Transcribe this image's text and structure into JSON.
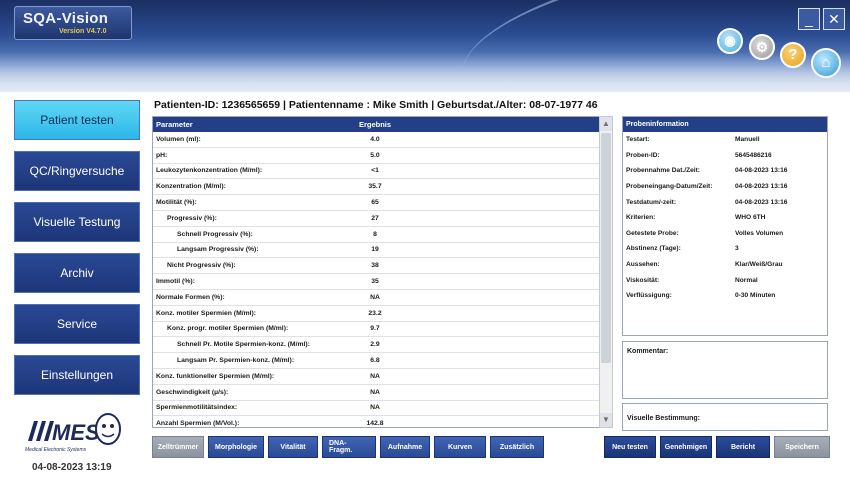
{
  "app": {
    "name": "SQA-Vision",
    "version": "Version V4.7.0"
  },
  "header": {
    "icons": [
      "eye-icon",
      "gear-icon",
      "help-icon",
      "home-icon"
    ],
    "window": {
      "minimize": "_",
      "close": "✕"
    }
  },
  "sidebar": {
    "items": [
      {
        "label": "Patient testen",
        "active": true
      },
      {
        "label": "QC/Ringversuche",
        "active": false
      },
      {
        "label": "Visuelle Testung",
        "active": false
      },
      {
        "label": "Archiv",
        "active": false
      },
      {
        "label": "Service",
        "active": false
      },
      {
        "label": "Einstellungen",
        "active": false
      }
    ],
    "logo_text": "MES",
    "logo_subtitle": "Medical Electronic Systems",
    "datetime": "04-08-2023 13:19"
  },
  "patient": {
    "line": "Patienten-ID: 1236565659 | Patientenname : Mike Smith | Geburtsdat./Alter: 08-07-1977 46"
  },
  "table": {
    "headers": [
      "Parameter",
      "Ergebnis"
    ],
    "rows": [
      {
        "param": "Volumen (ml):",
        "value": "4.0",
        "level": 0
      },
      {
        "param": "pH:",
        "value": "5.0",
        "level": 0
      },
      {
        "param": "Leukozytenkonzentration (M/ml):",
        "value": "<1",
        "level": 0
      },
      {
        "param": "Konzentration (M/ml):",
        "value": "35.7",
        "level": 0
      },
      {
        "param": "Motilität (%):",
        "value": "65",
        "level": 0
      },
      {
        "param": "Progressiv (%):",
        "value": "27",
        "level": 1
      },
      {
        "param": "Schnell Progressiv (%):",
        "value": "8",
        "level": 2
      },
      {
        "param": "Langsam Progressiv (%):",
        "value": "19",
        "level": 2
      },
      {
        "param": "Nicht Progressiv (%):",
        "value": "38",
        "level": 1
      },
      {
        "param": "Immotil (%):",
        "value": "35",
        "level": 0
      },
      {
        "param": "Normale Formen (%):",
        "value": "NA",
        "level": 0
      },
      {
        "param": "Konz. motiler Spermien (M/ml):",
        "value": "23.2",
        "level": 0
      },
      {
        "param": "Konz. progr. motiler Spermien (M/ml):",
        "value": "9.7",
        "level": 1
      },
      {
        "param": "Schnell Pr. Motile Spermien-konz. (M/ml):",
        "value": "2.9",
        "level": 2
      },
      {
        "param": "Langsam Pr. Spermien-konz. (M/ml):",
        "value": "6.8",
        "level": 2
      },
      {
        "param": "Konz. funktioneller Spermien (M/ml):",
        "value": "NA",
        "level": 0
      },
      {
        "param": "Geschwindigkeit (µ/s):",
        "value": "NA",
        "level": 0
      },
      {
        "param": "Spermienmotilitätsindex:",
        "value": "NA",
        "level": 0
      },
      {
        "param": "Anzahl Spermien (M/Vol.):",
        "value": "142.8",
        "level": 0
      }
    ]
  },
  "tabs": [
    {
      "label": "Zelltrümmer",
      "muted": true
    },
    {
      "label": "Morphologie",
      "muted": false
    },
    {
      "label": "Vitalität",
      "muted": false
    },
    {
      "label": "DNA-Fragm.",
      "muted": false
    },
    {
      "label": "Aufnahme",
      "muted": false
    },
    {
      "label": "Kurven",
      "muted": false
    },
    {
      "label": "Zusätzlich",
      "muted": false
    }
  ],
  "info": {
    "title": "Probeninformation",
    "rows": [
      {
        "key": "Testart:",
        "value": "Manuell"
      },
      {
        "key": "Proben-ID:",
        "value": "5645486216"
      },
      {
        "key": "Probennahme Dat./Zeit:",
        "value": "04-08-2023 13:16"
      },
      {
        "key": "Probeneingang-Datum/Zeit:",
        "value": "04-08-2023 13:16"
      },
      {
        "key": "Testdatum/-zeit:",
        "value": "04-08-2023 13:16"
      },
      {
        "key": "Kriterien:",
        "value": "WHO 6TH"
      },
      {
        "key": "Getestete Probe:",
        "value": "Volles Volumen"
      },
      {
        "key": "Abstinenz (Tage):",
        "value": "3"
      },
      {
        "key": "Aussehen:",
        "value": "Klar/Weiß/Grau"
      },
      {
        "key": "Viskosität:",
        "value": "Normal"
      },
      {
        "key": "Verflüssigung:",
        "value": "0-30 Minuten"
      }
    ],
    "comment_label": "Kommentar:",
    "visual_label": "Visuelle Bestimmung:"
  },
  "actions": [
    {
      "label": "Neu testen",
      "muted": false
    },
    {
      "label": "Genehmigen",
      "muted": false
    },
    {
      "label": "Bericht",
      "muted": false
    },
    {
      "label": "Speichern",
      "muted": true
    }
  ]
}
